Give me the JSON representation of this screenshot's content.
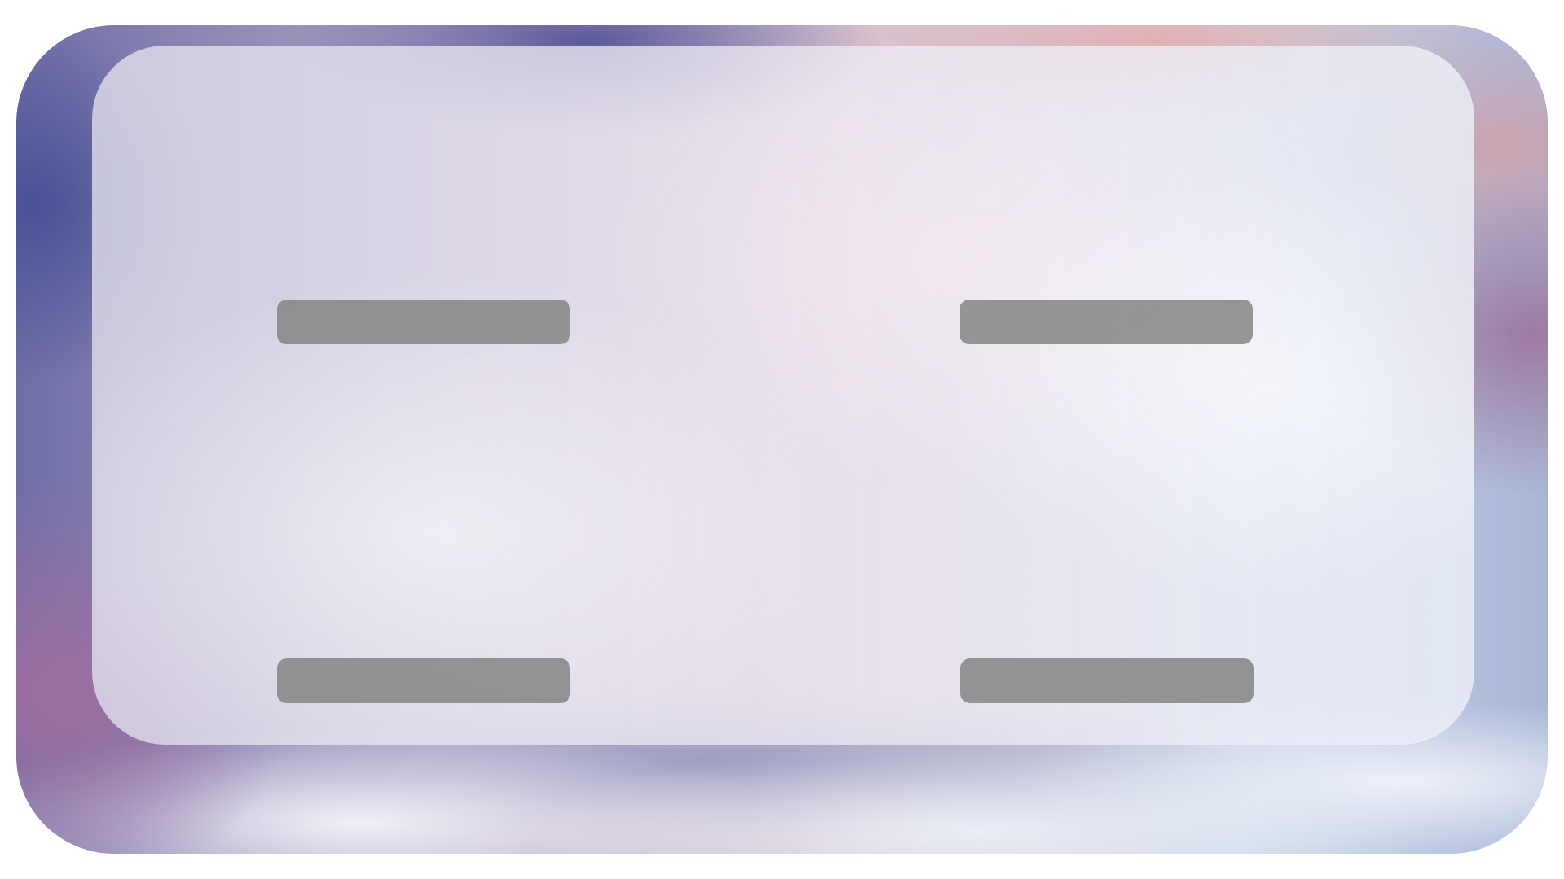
{
  "theme": {
    "panel_color": "#eeeef6",
    "bar_color": "#808080"
  },
  "panel": {
    "bars": [
      {
        "label": ""
      },
      {
        "label": ""
      },
      {
        "label": ""
      },
      {
        "label": ""
      }
    ]
  }
}
